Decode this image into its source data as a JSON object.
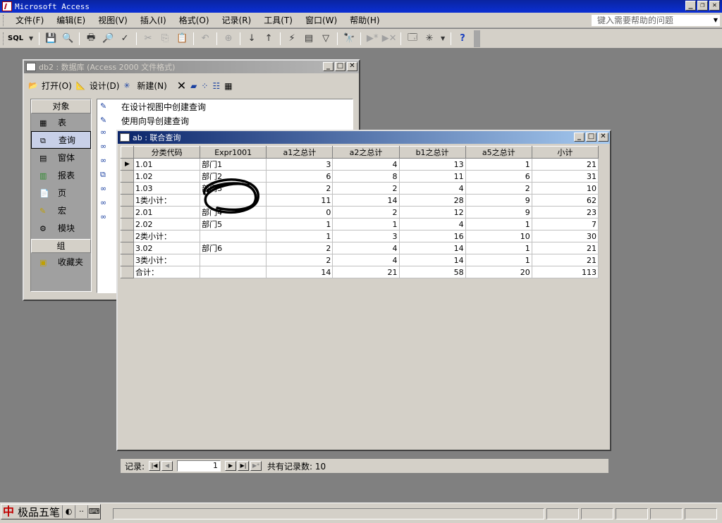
{
  "app": {
    "title": "Microsoft Access"
  },
  "menu": {
    "items": [
      "文件(F)",
      "编辑(E)",
      "视图(V)",
      "插入(I)",
      "格式(O)",
      "记录(R)",
      "工具(T)",
      "窗口(W)",
      "帮助(H)"
    ],
    "help_placeholder": "键入需要帮助的问题"
  },
  "toolbar": {
    "sql_label": "SQL"
  },
  "db_window": {
    "title": "db2 : 数据库 (Access 2000 文件格式)",
    "buttons": {
      "open": "打开(O)",
      "design": "设计(D)",
      "new": "新建(N)"
    },
    "objects_header": "对象",
    "objects": [
      "表",
      "查询",
      "窗体",
      "报表",
      "页",
      "宏",
      "模块"
    ],
    "selected_object": "查询",
    "groups_header": "组",
    "groups": [
      "收藏夹"
    ],
    "list": [
      "在设计视图中创建查询",
      "使用向导创建查询"
    ]
  },
  "query_window": {
    "title": "ab : 联合查询",
    "columns": [
      "分类代码",
      "Expr1001",
      "a1之总计",
      "a2之总计",
      "b1之总计",
      "a5之总计",
      "小计"
    ],
    "rows": [
      [
        "1.01",
        "部门1",
        "3",
        "4",
        "13",
        "1",
        "21"
      ],
      [
        "1.02",
        "部门2",
        "6",
        "8",
        "11",
        "6",
        "31"
      ],
      [
        "1.03",
        "部门3",
        "2",
        "2",
        "4",
        "2",
        "10"
      ],
      [
        "1类小计：",
        "",
        "11",
        "14",
        "28",
        "9",
        "62"
      ],
      [
        "2.01",
        "部门4",
        "0",
        "2",
        "12",
        "9",
        "23"
      ],
      [
        "2.02",
        "部门5",
        "1",
        "1",
        "4",
        "1",
        "7"
      ],
      [
        "2类小计：",
        "",
        "1",
        "3",
        "16",
        "10",
        "30"
      ],
      [
        "3.02",
        "部门6",
        "2",
        "4",
        "14",
        "1",
        "21"
      ],
      [
        "3类小计：",
        "",
        "2",
        "4",
        "14",
        "1",
        "21"
      ],
      [
        "合计：",
        "",
        "14",
        "21",
        "58",
        "20",
        "113"
      ]
    ],
    "nav": {
      "label": "记录:",
      "current": "1",
      "total_text": "共有记录数: 10"
    }
  },
  "ime": {
    "name": "极品五笔"
  }
}
